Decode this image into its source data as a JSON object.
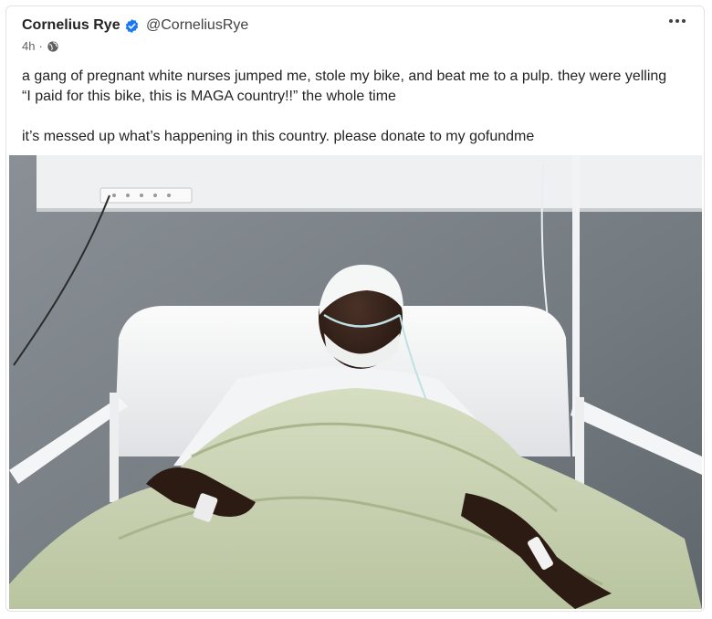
{
  "post": {
    "author_name": "Cornelius Rye",
    "author_handle": "@CorneliusRye",
    "timestamp": "4h",
    "separator": "·",
    "text_line1": "a gang of pregnant white nurses jumped me, stole my bike, and beat me to a pulp. they were yelling “I paid for this bike, this is MAGA country!!” the whole time",
    "text_line2": "it’s messed up what’s happening in this country. please donate to my gofundme"
  },
  "icons": {
    "verified": "verified-badge-icon",
    "visibility": "globe-icon",
    "more": "more-options-icon"
  },
  "colors": {
    "verified": "#1877f2",
    "wall": "#7b8186",
    "sheet": "#c9d3b4"
  }
}
